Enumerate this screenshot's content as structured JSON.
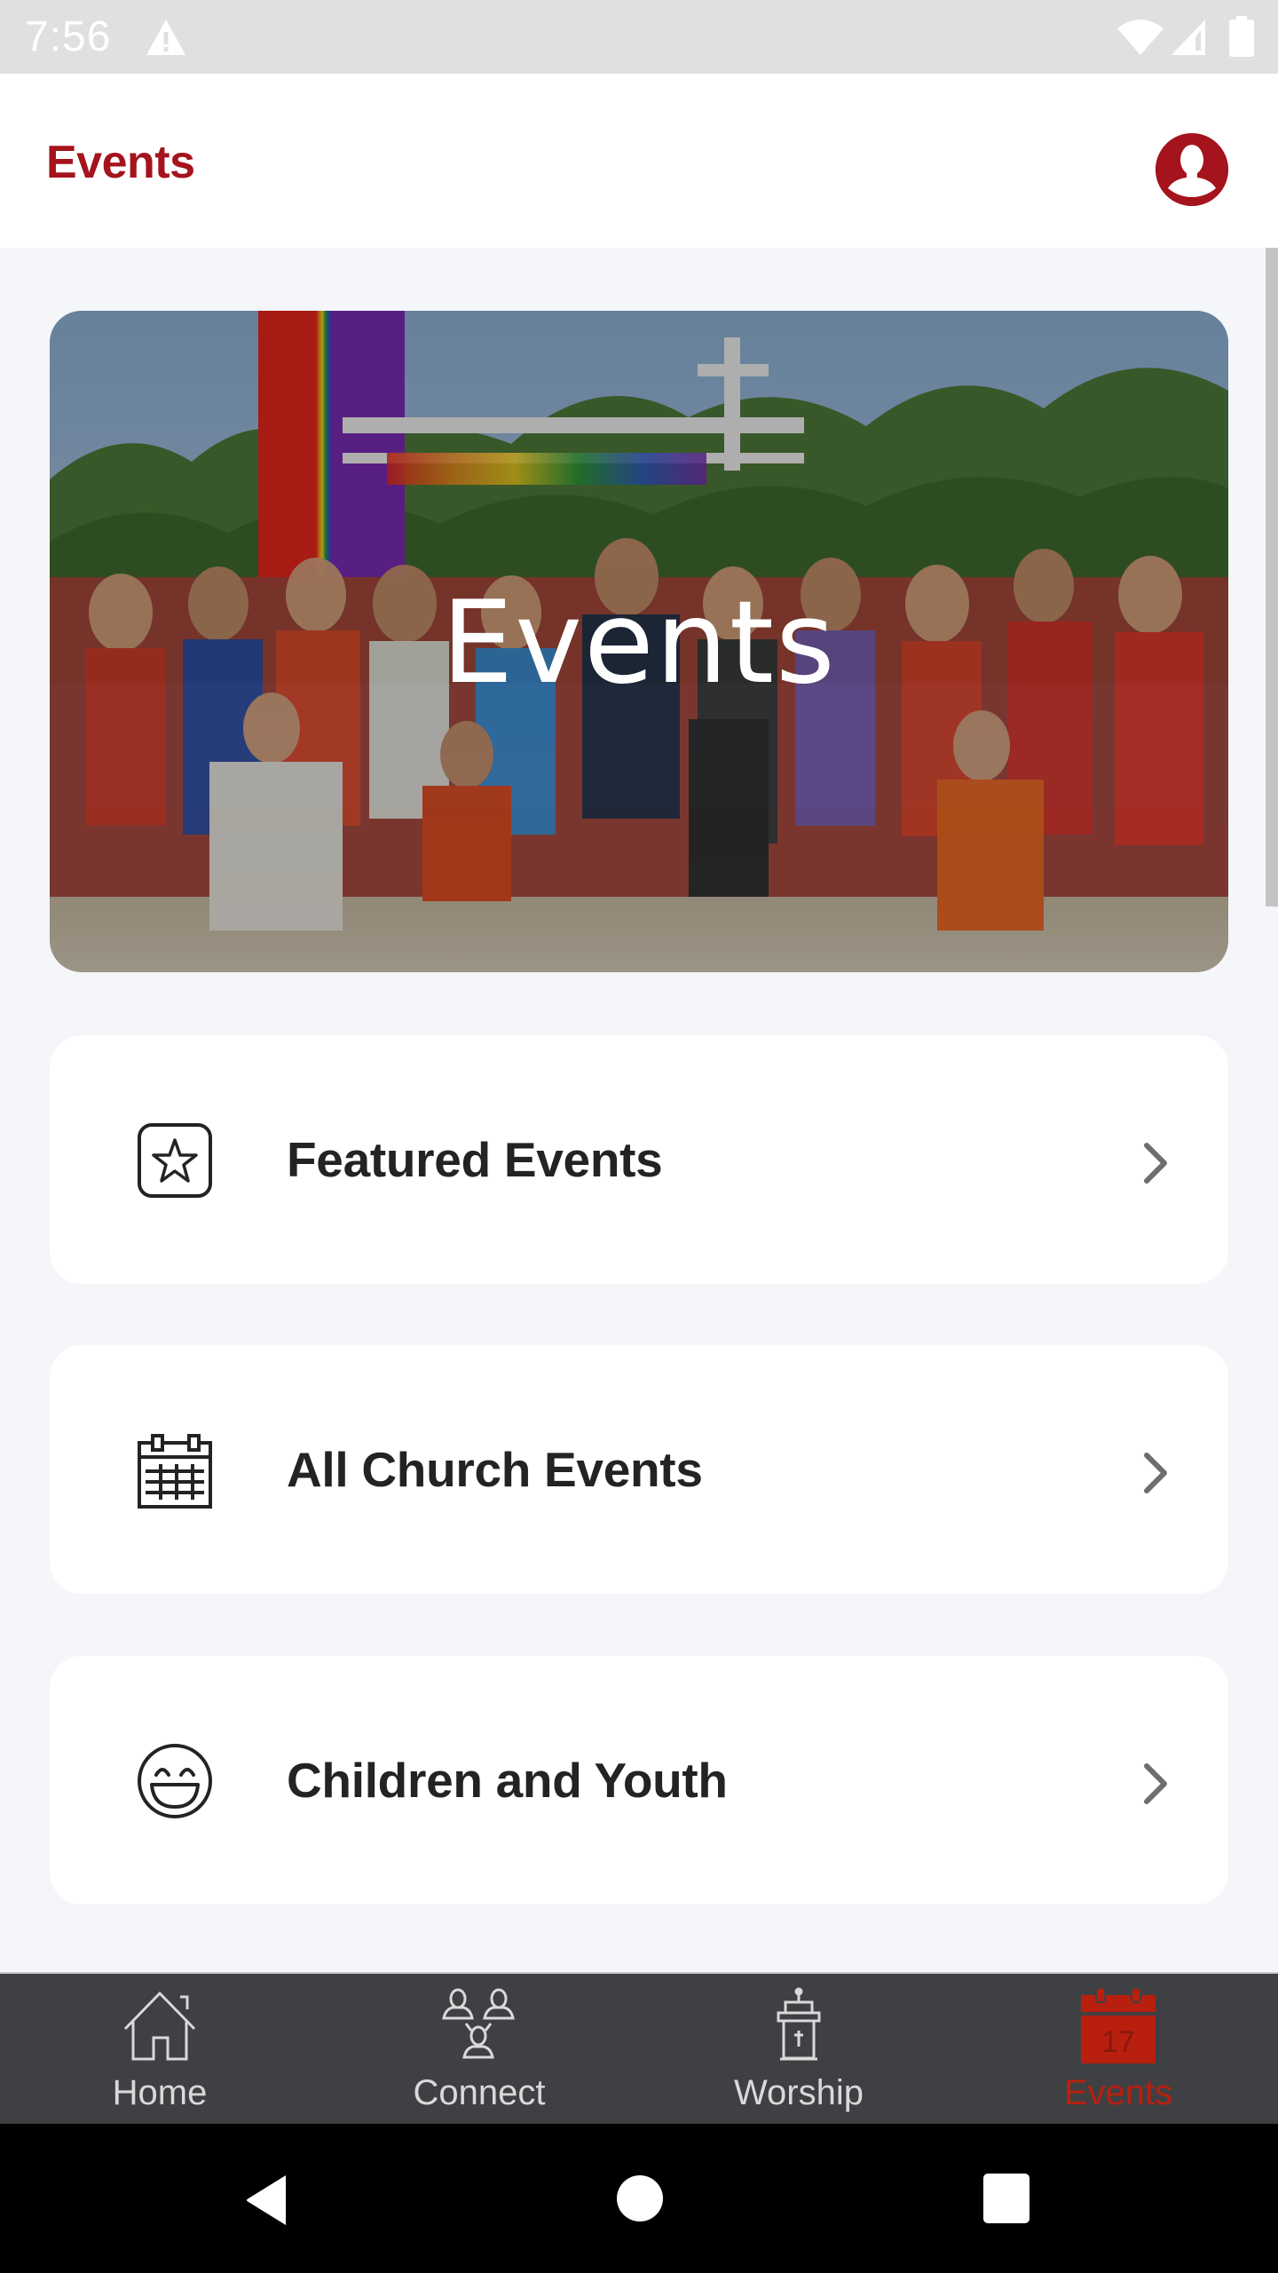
{
  "status_bar": {
    "time": "7:56",
    "icons": [
      "warning-icon",
      "wifi-icon",
      "signal-icon",
      "battery-icon"
    ]
  },
  "header": {
    "title": "Events",
    "profile_icon": "account-circle-icon"
  },
  "hero": {
    "title": "Events",
    "image_description": "Group photo of church members at a pride event on the beach with a 'Love is Love' sign"
  },
  "menu": {
    "items": [
      {
        "label": "Featured Events",
        "icon": "star-badge-icon"
      },
      {
        "label": "All Church Events",
        "icon": "calendar-icon"
      },
      {
        "label": "Children and Youth",
        "icon": "smiley-icon"
      }
    ]
  },
  "bottom_nav": {
    "active": "Events",
    "items": [
      {
        "label": "Home",
        "icon": "home-icon"
      },
      {
        "label": "Connect",
        "icon": "people-network-icon"
      },
      {
        "label": "Worship",
        "icon": "pulpit-icon"
      },
      {
        "label": "Events",
        "icon": "calendar-17-icon",
        "icon_text": "17"
      }
    ]
  },
  "colors": {
    "brand": "#a5131c",
    "active_nav": "#b81f0f",
    "nav_background": "#3f4043",
    "page_background": "#f4f6f9"
  }
}
